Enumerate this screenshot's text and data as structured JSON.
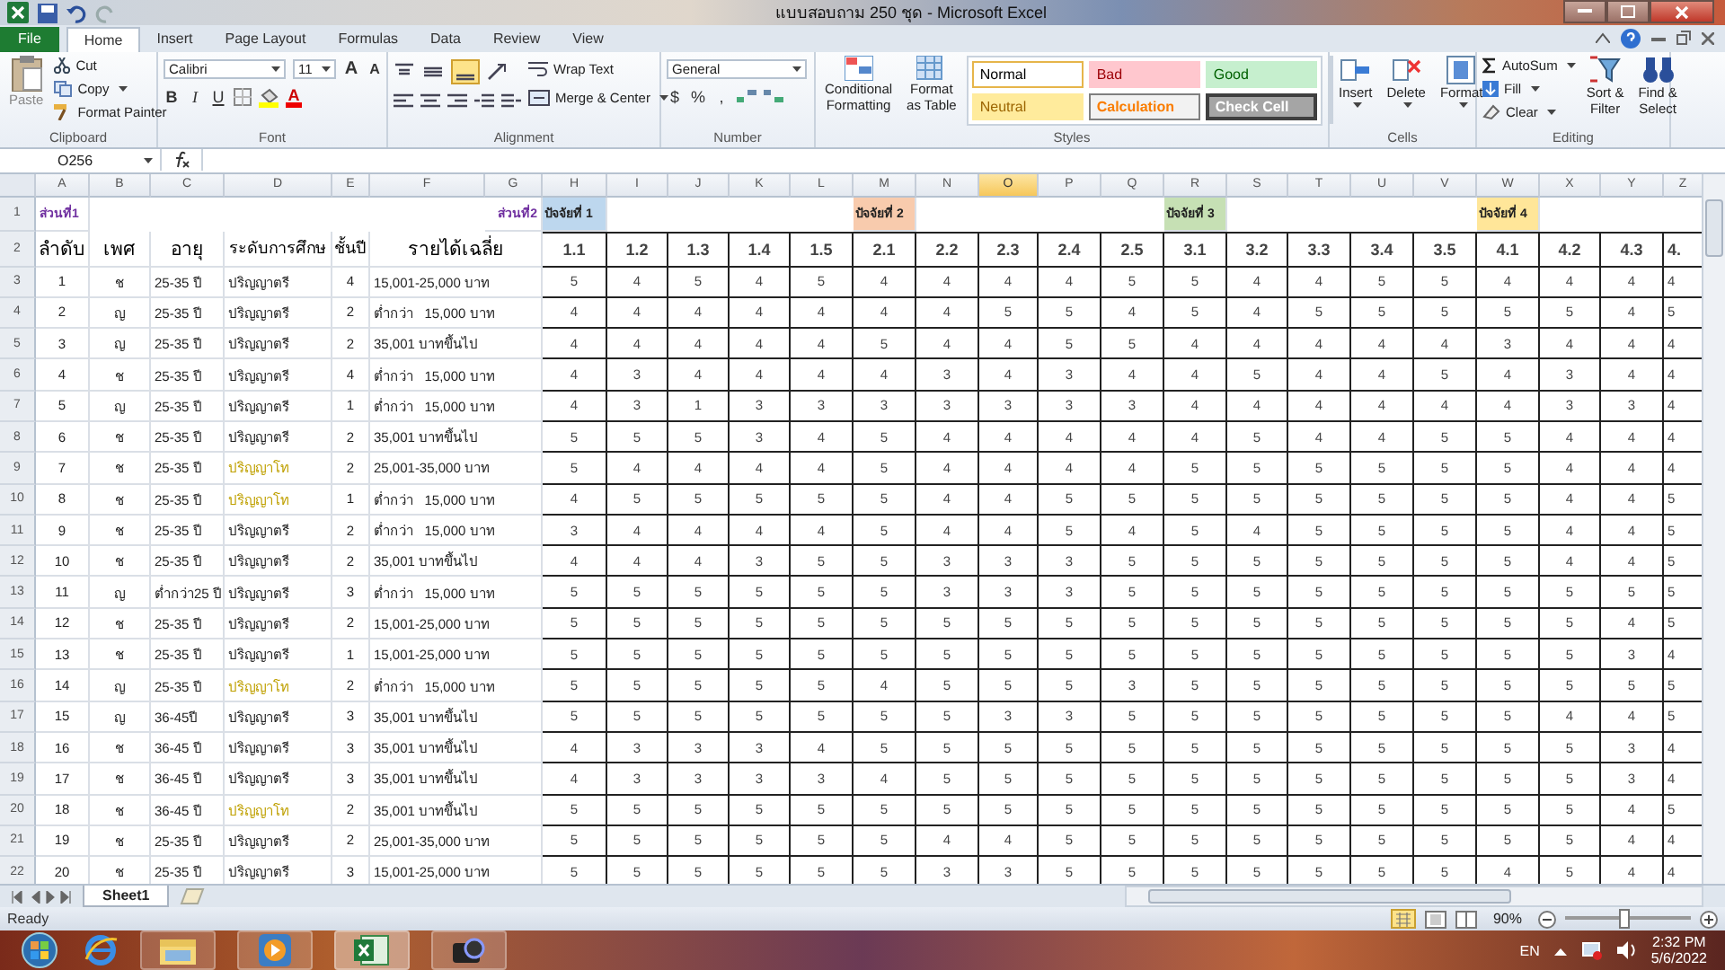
{
  "window": {
    "title": "แบบสอบถาม 250 ชุด - Microsoft Excel"
  },
  "tabs": [
    {
      "label": "File",
      "kind": "file",
      "selected": false
    },
    {
      "label": "Home",
      "kind": "tab",
      "selected": true
    },
    {
      "label": "Insert",
      "kind": "tab",
      "selected": false
    },
    {
      "label": "Page Layout",
      "kind": "tab",
      "selected": false
    },
    {
      "label": "Formulas",
      "kind": "tab",
      "selected": false
    },
    {
      "label": "Data",
      "kind": "tab",
      "selected": false
    },
    {
      "label": "Review",
      "kind": "tab",
      "selected": false
    },
    {
      "label": "View",
      "kind": "tab",
      "selected": false
    }
  ],
  "ribbon": {
    "clipboard": {
      "label": "Clipboard",
      "paste": "Paste",
      "cut": "Cut",
      "copy": "Copy",
      "format_painter": "Format Painter"
    },
    "font": {
      "label": "Font",
      "font_name": "Calibri",
      "font_size": "11",
      "grow": "A",
      "shrink": "A",
      "bold": "B",
      "italic": "I",
      "underline": "U",
      "font_color": "A"
    },
    "alignment": {
      "label": "Alignment",
      "wrap_text": "Wrap Text",
      "merge_center": "Merge & Center"
    },
    "number": {
      "label": "Number",
      "format": "General",
      "currency": "$",
      "percent": "%",
      "comma": ","
    },
    "styles": {
      "label": "Styles",
      "conditional": [
        "Conditional",
        "Formatting"
      ],
      "format_table": [
        "Format",
        "as Table"
      ],
      "gallery": [
        {
          "label": "Normal",
          "kind": "normal"
        },
        {
          "label": "Bad",
          "kind": "bad"
        },
        {
          "label": "Good",
          "kind": "good"
        },
        {
          "label": "Neutral",
          "kind": "neutral"
        },
        {
          "label": "Calculation",
          "kind": "calculation"
        },
        {
          "label": "Check Cell",
          "kind": "check"
        }
      ]
    },
    "cells": {
      "label": "Cells",
      "insert": "Insert",
      "delete": "Delete",
      "format": "Format"
    },
    "editing": {
      "label": "Editing",
      "autosum": "AutoSum",
      "fill": "Fill",
      "clear": "Clear",
      "sort_filter": [
        "Sort &",
        "Filter"
      ],
      "find_select": [
        "Find &",
        "Select"
      ]
    }
  },
  "formula_bar": {
    "name_box": "O256"
  },
  "columns": [
    {
      "letter": "A",
      "selected": false
    },
    {
      "letter": "B",
      "selected": false
    },
    {
      "letter": "C",
      "selected": false
    },
    {
      "letter": "D",
      "selected": false
    },
    {
      "letter": "E",
      "selected": false
    },
    {
      "letter": "F",
      "selected": false
    },
    {
      "letter": "G",
      "selected": false
    },
    {
      "letter": "H",
      "selected": false
    },
    {
      "letter": "I",
      "selected": false
    },
    {
      "letter": "J",
      "selected": false
    },
    {
      "letter": "K",
      "selected": false
    },
    {
      "letter": "L",
      "selected": false
    },
    {
      "letter": "M",
      "selected": false
    },
    {
      "letter": "N",
      "selected": false
    },
    {
      "letter": "O",
      "selected": true
    },
    {
      "letter": "P",
      "selected": false
    },
    {
      "letter": "Q",
      "selected": false
    },
    {
      "letter": "R",
      "selected": false
    },
    {
      "letter": "S",
      "selected": false
    },
    {
      "letter": "T",
      "selected": false
    },
    {
      "letter": "U",
      "selected": false
    },
    {
      "letter": "V",
      "selected": false
    },
    {
      "letter": "W",
      "selected": false
    },
    {
      "letter": "X",
      "selected": false
    },
    {
      "letter": "Y",
      "selected": false
    },
    {
      "letter": "Z",
      "selected": false
    }
  ],
  "section_row": {
    "row_number": "1",
    "part_1": "ส่วนที่1",
    "part_2": "ส่วนที่2",
    "factors": [
      {
        "label": "ปัจจัยที่ 1",
        "color": "#bdd7ee"
      },
      {
        "label": "ปัจจัยที่ 2",
        "color": "#f8cbad"
      },
      {
        "label": "ปัจจัยที่ 3",
        "color": "#c6e0b4"
      },
      {
        "label": "ปัจจัยที่ 4",
        "color": "#ffe699"
      }
    ]
  },
  "header_row": {
    "row_number": "2",
    "no": "ลำดับ",
    "sex": "เพศ",
    "age": "อายุ",
    "education": "ระดับการศึกษ",
    "year": "ชั้นปี",
    "income": "รายได้เฉลี่ย",
    "items": [
      "1.1",
      "1.2",
      "1.3",
      "1.4",
      "1.5",
      "2.1",
      "2.2",
      "2.3",
      "2.4",
      "2.5",
      "3.1",
      "3.2",
      "3.3",
      "3.4",
      "3.5",
      "4.1",
      "4.2",
      "4.3",
      "4."
    ]
  },
  "rows": [
    {
      "row_number": "3",
      "no": "1",
      "sex": "ช",
      "age": "25-35 ปี",
      "education": "ปริญญาตรี",
      "highlighted": false,
      "year": "4",
      "income": "15,001-25,000 บาท",
      "scores": [
        "5",
        "4",
        "5",
        "4",
        "5",
        "4",
        "4",
        "4",
        "4",
        "5",
        "5",
        "4",
        "4",
        "5",
        "5",
        "4",
        "4",
        "4",
        "4"
      ]
    },
    {
      "row_number": "4",
      "no": "2",
      "sex": "ญ",
      "age": "25-35 ปี",
      "education": "ปริญญาตรี",
      "highlighted": false,
      "year": "2",
      "income": "ต่ำกว่า   15,000 บาท",
      "scores": [
        "4",
        "4",
        "4",
        "4",
        "4",
        "4",
        "4",
        "5",
        "5",
        "4",
        "5",
        "4",
        "5",
        "5",
        "5",
        "5",
        "5",
        "4",
        "5"
      ]
    },
    {
      "row_number": "5",
      "no": "3",
      "sex": "ญ",
      "age": "25-35 ปี",
      "education": "ปริญญาตรี",
      "highlighted": false,
      "year": "2",
      "income": "35,001 บาทขึ้นไป",
      "scores": [
        "4",
        "4",
        "4",
        "4",
        "4",
        "5",
        "4",
        "4",
        "5",
        "5",
        "4",
        "4",
        "4",
        "4",
        "4",
        "3",
        "4",
        "4",
        "4"
      ]
    },
    {
      "row_number": "6",
      "no": "4",
      "sex": "ช",
      "age": "25-35 ปี",
      "education": "ปริญญาตรี",
      "highlighted": false,
      "year": "4",
      "income": "ต่ำกว่า   15,000 บาท",
      "scores": [
        "4",
        "3",
        "4",
        "4",
        "4",
        "4",
        "3",
        "4",
        "3",
        "4",
        "4",
        "5",
        "4",
        "4",
        "5",
        "4",
        "3",
        "4",
        "4"
      ]
    },
    {
      "row_number": "7",
      "no": "5",
      "sex": "ญ",
      "age": "25-35 ปี",
      "education": "ปริญญาตรี",
      "highlighted": false,
      "year": "1",
      "income": "ต่ำกว่า   15,000 บาท",
      "scores": [
        "4",
        "3",
        "1",
        "3",
        "3",
        "3",
        "3",
        "3",
        "3",
        "3",
        "4",
        "4",
        "4",
        "4",
        "4",
        "4",
        "3",
        "3",
        "4"
      ]
    },
    {
      "row_number": "8",
      "no": "6",
      "sex": "ช",
      "age": "25-35 ปี",
      "education": "ปริญญาตรี",
      "highlighted": false,
      "year": "2",
      "income": "35,001 บาทขึ้นไป",
      "scores": [
        "5",
        "5",
        "5",
        "3",
        "4",
        "5",
        "4",
        "4",
        "4",
        "4",
        "4",
        "5",
        "4",
        "4",
        "5",
        "5",
        "4",
        "4",
        "4"
      ]
    },
    {
      "row_number": "9",
      "no": "7",
      "sex": "ช",
      "age": "25-35 ปี",
      "education": "ปริญญาโท",
      "highlighted": true,
      "year": "2",
      "income": "25,001-35,000 บาท",
      "scores": [
        "5",
        "4",
        "4",
        "4",
        "4",
        "5",
        "4",
        "4",
        "4",
        "4",
        "5",
        "5",
        "5",
        "5",
        "5",
        "5",
        "4",
        "4",
        "4"
      ]
    },
    {
      "row_number": "10",
      "no": "8",
      "sex": "ช",
      "age": "25-35 ปี",
      "education": "ปริญญาโท",
      "highlighted": true,
      "year": "1",
      "income": "ต่ำกว่า   15,000 บาท",
      "scores": [
        "4",
        "5",
        "5",
        "5",
        "5",
        "5",
        "4",
        "4",
        "5",
        "5",
        "5",
        "5",
        "5",
        "5",
        "5",
        "5",
        "4",
        "4",
        "5"
      ]
    },
    {
      "row_number": "11",
      "no": "9",
      "sex": "ช",
      "age": "25-35 ปี",
      "education": "ปริญญาตรี",
      "highlighted": false,
      "year": "2",
      "income": "ต่ำกว่า   15,000 บาท",
      "scores": [
        "3",
        "4",
        "4",
        "4",
        "4",
        "5",
        "4",
        "4",
        "5",
        "4",
        "5",
        "4",
        "5",
        "5",
        "5",
        "5",
        "4",
        "4",
        "5"
      ]
    },
    {
      "row_number": "12",
      "no": "10",
      "sex": "ช",
      "age": "25-35 ปี",
      "education": "ปริญญาตรี",
      "highlighted": false,
      "year": "2",
      "income": "35,001 บาทขึ้นไป",
      "scores": [
        "4",
        "4",
        "4",
        "3",
        "5",
        "5",
        "3",
        "3",
        "3",
        "5",
        "5",
        "5",
        "5",
        "5",
        "5",
        "5",
        "4",
        "4",
        "5"
      ]
    },
    {
      "row_number": "13",
      "no": "11",
      "sex": "ญ",
      "age": "ต่ำกว่า25 ปี",
      "education": "ปริญญาตรี",
      "highlighted": false,
      "year": "3",
      "income": "ต่ำกว่า   15,000 บาท",
      "scores": [
        "5",
        "5",
        "5",
        "5",
        "5",
        "5",
        "3",
        "3",
        "3",
        "5",
        "5",
        "5",
        "5",
        "5",
        "5",
        "5",
        "5",
        "5",
        "5"
      ]
    },
    {
      "row_number": "14",
      "no": "12",
      "sex": "ช",
      "age": "25-35 ปี",
      "education": "ปริญญาตรี",
      "highlighted": false,
      "year": "2",
      "income": "15,001-25,000 บาท",
      "scores": [
        "5",
        "5",
        "5",
        "5",
        "5",
        "5",
        "5",
        "5",
        "5",
        "5",
        "5",
        "5",
        "5",
        "5",
        "5",
        "5",
        "5",
        "4",
        "5"
      ]
    },
    {
      "row_number": "15",
      "no": "13",
      "sex": "ช",
      "age": "25-35 ปี",
      "education": "ปริญญาตรี",
      "highlighted": false,
      "year": "1",
      "income": "15,001-25,000 บาท",
      "scores": [
        "5",
        "5",
        "5",
        "5",
        "5",
        "5",
        "5",
        "5",
        "5",
        "5",
        "5",
        "5",
        "5",
        "5",
        "5",
        "5",
        "5",
        "3",
        "4"
      ]
    },
    {
      "row_number": "16",
      "no": "14",
      "sex": "ญ",
      "age": "25-35 ปี",
      "education": "ปริญญาโท",
      "highlighted": true,
      "year": "2",
      "income": "ต่ำกว่า   15,000 บาท",
      "scores": [
        "5",
        "5",
        "5",
        "5",
        "5",
        "4",
        "5",
        "5",
        "5",
        "3",
        "5",
        "5",
        "5",
        "5",
        "5",
        "5",
        "5",
        "5",
        "5"
      ]
    },
    {
      "row_number": "17",
      "no": "15",
      "sex": "ญ",
      "age": "36-45ปี",
      "education": "ปริญญาตรี",
      "highlighted": false,
      "year": "3",
      "income": "35,001 บาทขึ้นไป",
      "scores": [
        "5",
        "5",
        "5",
        "5",
        "5",
        "5",
        "5",
        "3",
        "3",
        "5",
        "5",
        "5",
        "5",
        "5",
        "5",
        "5",
        "4",
        "4",
        "5"
      ]
    },
    {
      "row_number": "18",
      "no": "16",
      "sex": "ช",
      "age": "36-45 ปี",
      "education": "ปริญญาตรี",
      "highlighted": false,
      "year": "3",
      "income": "35,001 บาทขึ้นไป",
      "scores": [
        "4",
        "3",
        "3",
        "3",
        "4",
        "5",
        "5",
        "5",
        "5",
        "5",
        "5",
        "5",
        "5",
        "5",
        "5",
        "5",
        "5",
        "3",
        "4"
      ]
    },
    {
      "row_number": "19",
      "no": "17",
      "sex": "ช",
      "age": "36-45 ปี",
      "education": "ปริญญาตรี",
      "highlighted": false,
      "year": "3",
      "income": "35,001 บาทขึ้นไป",
      "scores": [
        "4",
        "3",
        "3",
        "3",
        "3",
        "4",
        "5",
        "5",
        "5",
        "5",
        "5",
        "5",
        "5",
        "5",
        "5",
        "5",
        "5",
        "3",
        "4"
      ]
    },
    {
      "row_number": "20",
      "no": "18",
      "sex": "ช",
      "age": "36-45 ปี",
      "education": "ปริญญาโท",
      "highlighted": true,
      "year": "2",
      "income": "35,001 บาทขึ้นไป",
      "scores": [
        "5",
        "5",
        "5",
        "5",
        "5",
        "5",
        "5",
        "5",
        "5",
        "5",
        "5",
        "5",
        "5",
        "5",
        "5",
        "5",
        "5",
        "4",
        "5"
      ]
    },
    {
      "row_number": "21",
      "no": "19",
      "sex": "ช",
      "age": "25-35 ปี",
      "education": "ปริญญาตรี",
      "highlighted": false,
      "year": "2",
      "income": "25,001-35,000 บาท",
      "scores": [
        "5",
        "5",
        "5",
        "5",
        "5",
        "5",
        "4",
        "4",
        "5",
        "5",
        "5",
        "5",
        "5",
        "5",
        "5",
        "5",
        "5",
        "4",
        "4"
      ]
    },
    {
      "row_number": "22",
      "no": "20",
      "sex": "ช",
      "age": "25-35 ปี",
      "education": "ปริญญาตรี",
      "highlighted": false,
      "year": "3",
      "income": "15,001-25,000 บาท",
      "scores": [
        "5",
        "5",
        "5",
        "5",
        "5",
        "5",
        "3",
        "3",
        "5",
        "5",
        "5",
        "5",
        "5",
        "5",
        "5",
        "4",
        "5",
        "4",
        "4"
      ]
    }
  ],
  "sheet_tabs": [
    {
      "label": "Sheet1",
      "selected": true
    }
  ],
  "status_bar": {
    "status": "Ready",
    "zoom": "90%",
    "zoom_slider": {
      "level": 0.45
    }
  },
  "taskbar": {
    "language": "EN",
    "time": "2:32 PM",
    "date": "5/6/2022"
  }
}
